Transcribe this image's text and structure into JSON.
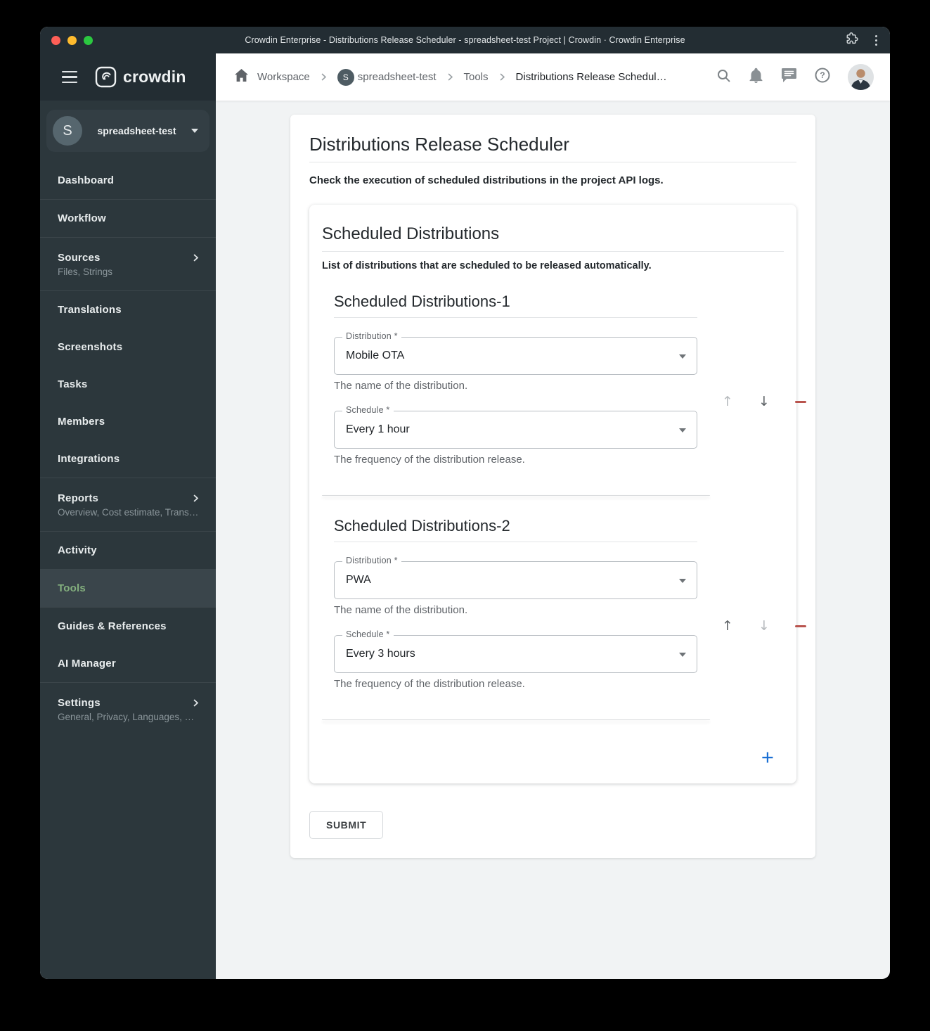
{
  "titlebar": {
    "title": "Crowdin Enterprise - Distributions Release Scheduler - spreadsheet-test Project | Crowdin · Crowdin Enterprise"
  },
  "brand": {
    "logo_text": "crowdin"
  },
  "sidebar": {
    "project": {
      "initial": "S",
      "name": "spreadsheet-test"
    },
    "items": [
      {
        "label": "Dashboard"
      },
      {
        "label": "Workflow",
        "divider": true
      },
      {
        "label": "Sources",
        "divider": true,
        "chevron": true,
        "sub": "Files, Strings"
      },
      {
        "label": "Translations",
        "divider": true
      },
      {
        "label": "Screenshots"
      },
      {
        "label": "Tasks"
      },
      {
        "label": "Members"
      },
      {
        "label": "Integrations"
      },
      {
        "label": "Reports",
        "divider": true,
        "chevron": true,
        "sub": "Overview, Cost estimate, Transl…"
      },
      {
        "label": "Activity",
        "divider": true
      },
      {
        "label": "Tools",
        "divider": true,
        "active": true
      },
      {
        "label": "Guides & References",
        "divider": true
      },
      {
        "label": "AI Manager"
      },
      {
        "label": "Settings",
        "divider": true,
        "chevron": true,
        "sub": "General, Privacy, Languages, Q…"
      }
    ]
  },
  "breadcrumb": {
    "workspace": "Workspace",
    "project_initial": "S",
    "project": "spreadsheet-test",
    "tools": "Tools",
    "current": "Distributions Release Schedul…"
  },
  "page": {
    "title": "Distributions Release Scheduler",
    "note": "Check the execution of scheduled distributions in the project API logs."
  },
  "card": {
    "title": "Scheduled Distributions",
    "description": "List of distributions that are scheduled to be released automatically.",
    "add_label": "+",
    "sections": [
      {
        "title": "Scheduled Distributions-1",
        "fields": [
          {
            "label": "Distribution",
            "required": "*",
            "value": "Mobile OTA",
            "helper": "The name of the distribution."
          },
          {
            "label": "Schedule",
            "required": "*",
            "value": "Every 1 hour",
            "helper": "The frequency of the distribution release."
          }
        ]
      },
      {
        "title": "Scheduled Distributions-2",
        "fields": [
          {
            "label": "Distribution",
            "required": "*",
            "value": "PWA",
            "helper": "The name of the distribution."
          },
          {
            "label": "Schedule",
            "required": "*",
            "value": "Every 3 hours",
            "helper": "The frequency of the distribution release."
          }
        ]
      }
    ]
  },
  "actions": {
    "submit": "SUBMIT"
  },
  "colors": {
    "accent_green": "#84b07e",
    "danger_red": "#b9544e",
    "link_blue": "#1a6fd4",
    "sidebar_bg": "#2c373c",
    "titlebar_bg": "#232d33"
  }
}
